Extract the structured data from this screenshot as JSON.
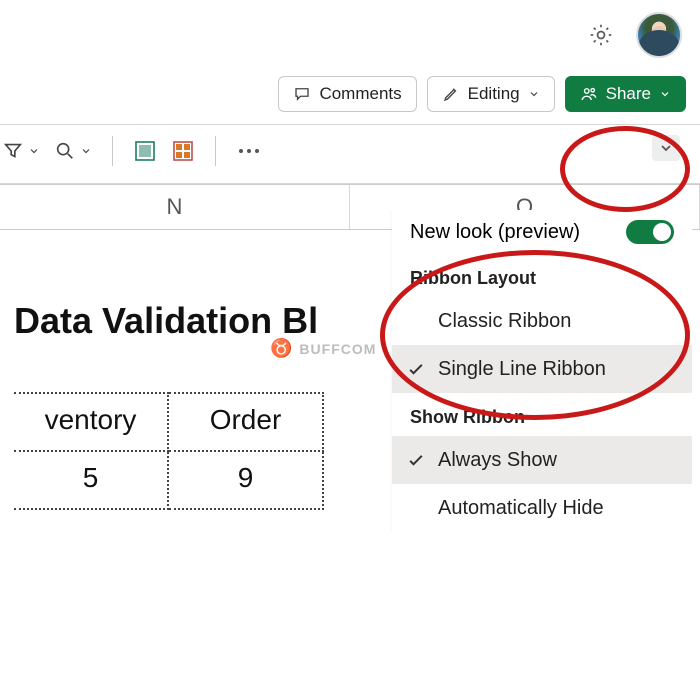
{
  "topbar": {
    "settings_icon": "gear-icon",
    "avatar": "user-avatar"
  },
  "actionbar": {
    "comments_label": "Comments",
    "editing_label": "Editing",
    "share_label": "Share"
  },
  "grid": {
    "columns": [
      "N",
      "O"
    ]
  },
  "content": {
    "title": "Data Validation Bl",
    "table": {
      "headers": [
        "ventory",
        "Order"
      ],
      "row": [
        "5",
        "9"
      ]
    }
  },
  "dropdown": {
    "preview_label": "New look (preview)",
    "preview_on": true,
    "section_layout": "Ribbon Layout",
    "option_classic": "Classic Ribbon",
    "option_single": "Single Line Ribbon",
    "section_show": "Show Ribbon",
    "option_always": "Always Show",
    "option_autohide": "Automatically Hide"
  },
  "watermark": {
    "text": "BUFFCOM"
  }
}
